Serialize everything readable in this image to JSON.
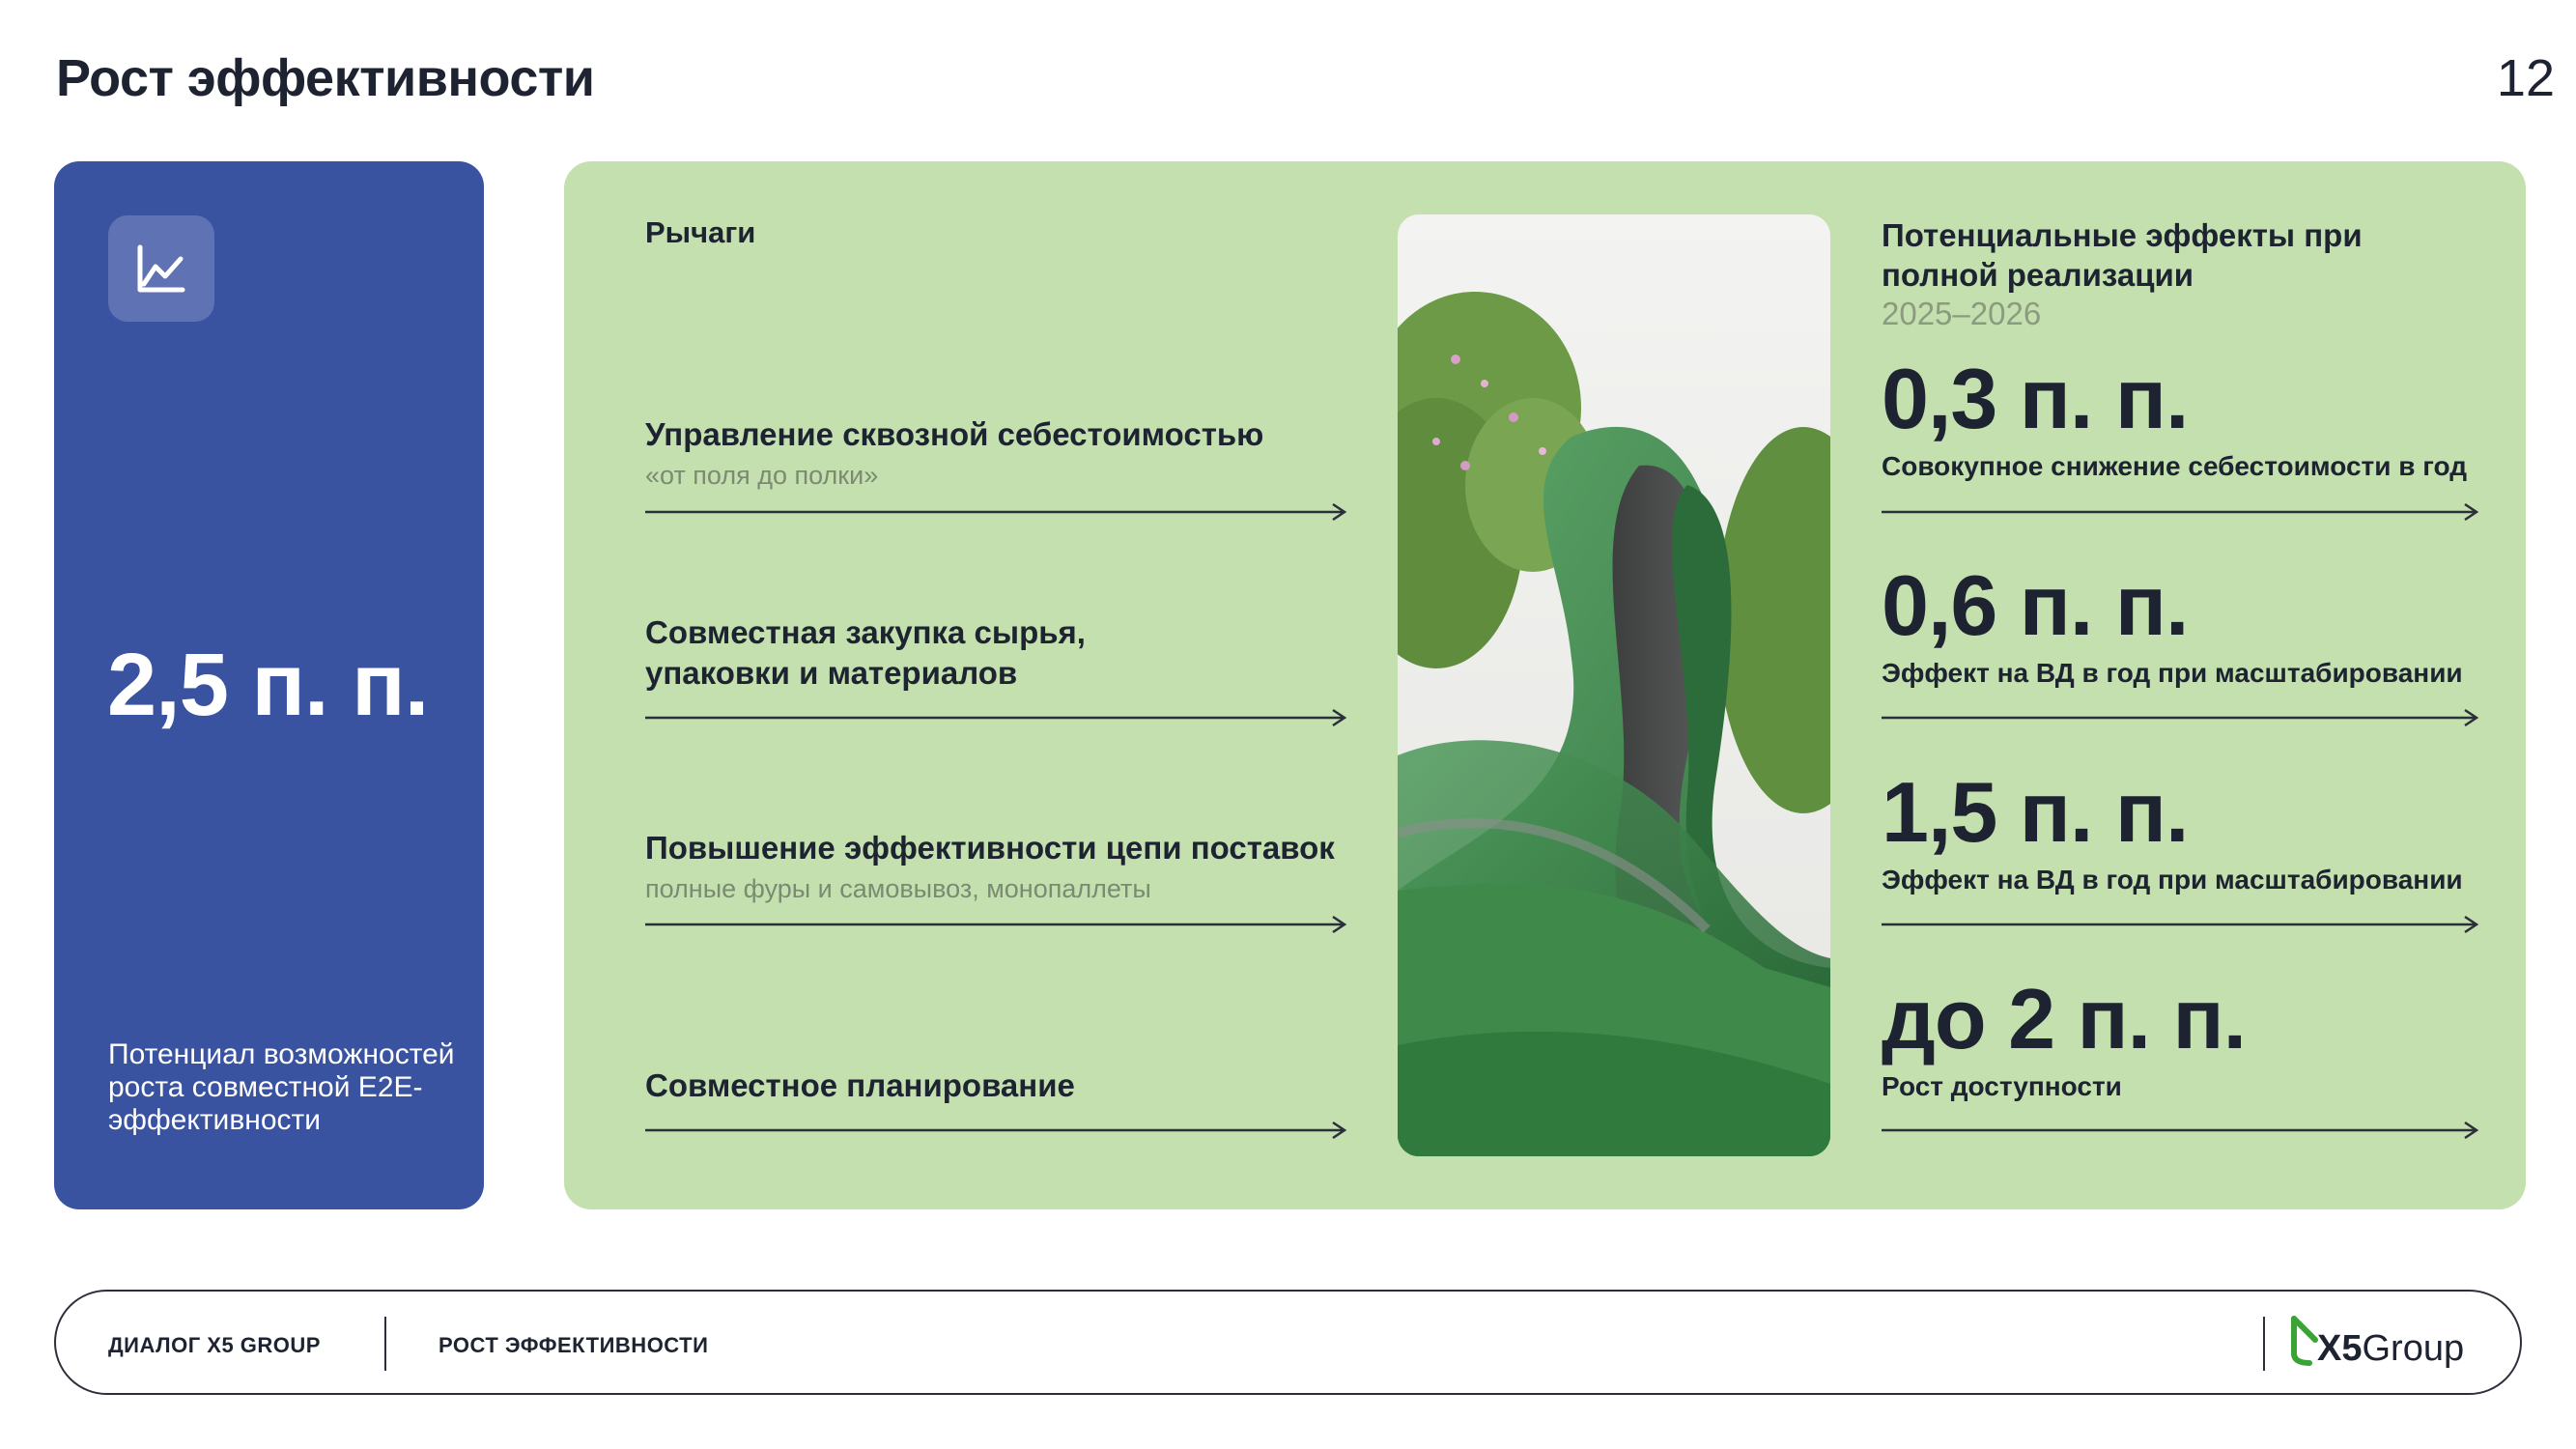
{
  "header": {
    "title": "Рост эффективности",
    "page_number": "12"
  },
  "summary": {
    "icon": "line-chart-icon",
    "value": "2,5 п. п.",
    "caption": "Потенциал возможностей роста совместной E2E-эффективности"
  },
  "levers": {
    "heading": "Рычаги",
    "items": [
      {
        "title": "Управление сквозной себестоимостью",
        "subtitle": "«от поля до полки»"
      },
      {
        "title": "Совместная закупка сырья, упаковки и материалов",
        "subtitle": ""
      },
      {
        "title": "Повышение эффективности цепи поставок",
        "subtitle": "полные фуры и самовывоз, монопаллеты"
      },
      {
        "title": "Совместное планирование",
        "subtitle": ""
      }
    ]
  },
  "effects": {
    "heading": "Потенциальные эффекты при полной реализации",
    "years": "2025–2026",
    "items": [
      {
        "value": "0,3 п. п.",
        "label": "Совокупное снижение себестоимости в год"
      },
      {
        "value": "0,6 п. п.",
        "label": "Эффект на ВД в год при масштабировании"
      },
      {
        "value": "1,5 п. п.",
        "label": "Эффект на ВД в год при масштабировании"
      },
      {
        "value": "до 2 п. п.",
        "label": "Рост доступности"
      }
    ]
  },
  "footer": {
    "left_label": "ДИАЛОГ X5 GROUP",
    "section_label": "РОСТ ЭФФЕКТИВНОСТИ",
    "logo_x5": "X5",
    "logo_group": "Group"
  },
  "colors": {
    "blue_card": "#3a53a0",
    "green_panel": "#c3e0ae",
    "text_dark": "#1d2330",
    "logo_green": "#3aa335"
  }
}
